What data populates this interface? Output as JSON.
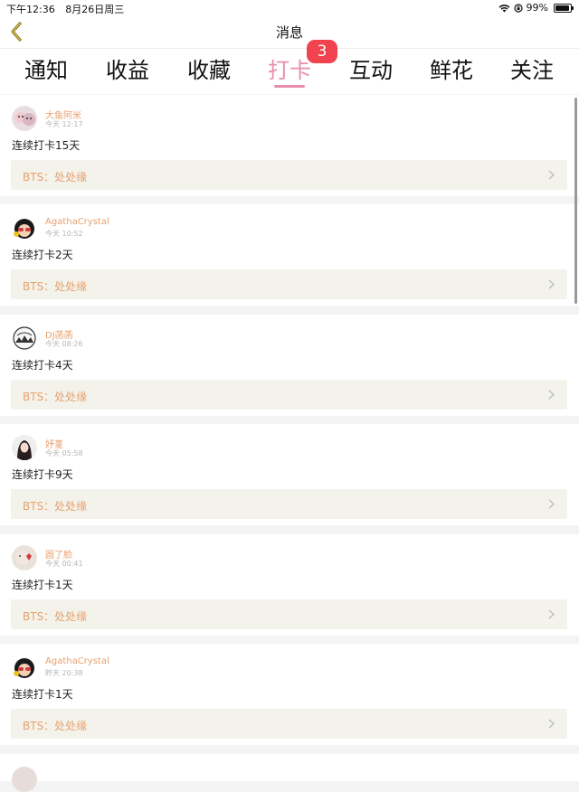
{
  "status_bar": {
    "time": "下午12:36",
    "date": "8月26日周三",
    "battery": "99%"
  },
  "nav": {
    "title": "消息"
  },
  "tabs": [
    {
      "label": "通知"
    },
    {
      "label": "收益"
    },
    {
      "label": "收藏"
    },
    {
      "label": "打卡",
      "active": true,
      "badge": "3"
    },
    {
      "label": "互动"
    },
    {
      "label": "鲜花"
    },
    {
      "label": "关注"
    }
  ],
  "feed": [
    {
      "username": "大鱼阿米",
      "time": "今天 12:17",
      "message": "连续打卡15天",
      "link": "BTS：处处缘"
    },
    {
      "username": "AgathaCrystal",
      "time": "今天 10:52",
      "message": "连续打卡2天",
      "link": "BTS：处处缘"
    },
    {
      "username": "DJ菡菡",
      "time": "今天 08:26",
      "message": "连续打卡4天",
      "link": "BTS：处处缘"
    },
    {
      "username": "妤堇",
      "time": "今天 05:58",
      "message": "连续打卡9天",
      "link": "BTS：处处缘"
    },
    {
      "username": "圆了脸",
      "time": "今天 00:41",
      "message": "连续打卡1天",
      "link": "BTS：处处缘"
    },
    {
      "username": "AgathaCrystal",
      "time": "昨天 20:38",
      "message": "连续打卡1天",
      "link": "BTS：处处缘"
    }
  ],
  "colors": {
    "accent_pink": "#e88dab",
    "username_orange": "#e8a06e",
    "badge_red": "#f0424f",
    "link_bg": "#f3f3ec"
  }
}
